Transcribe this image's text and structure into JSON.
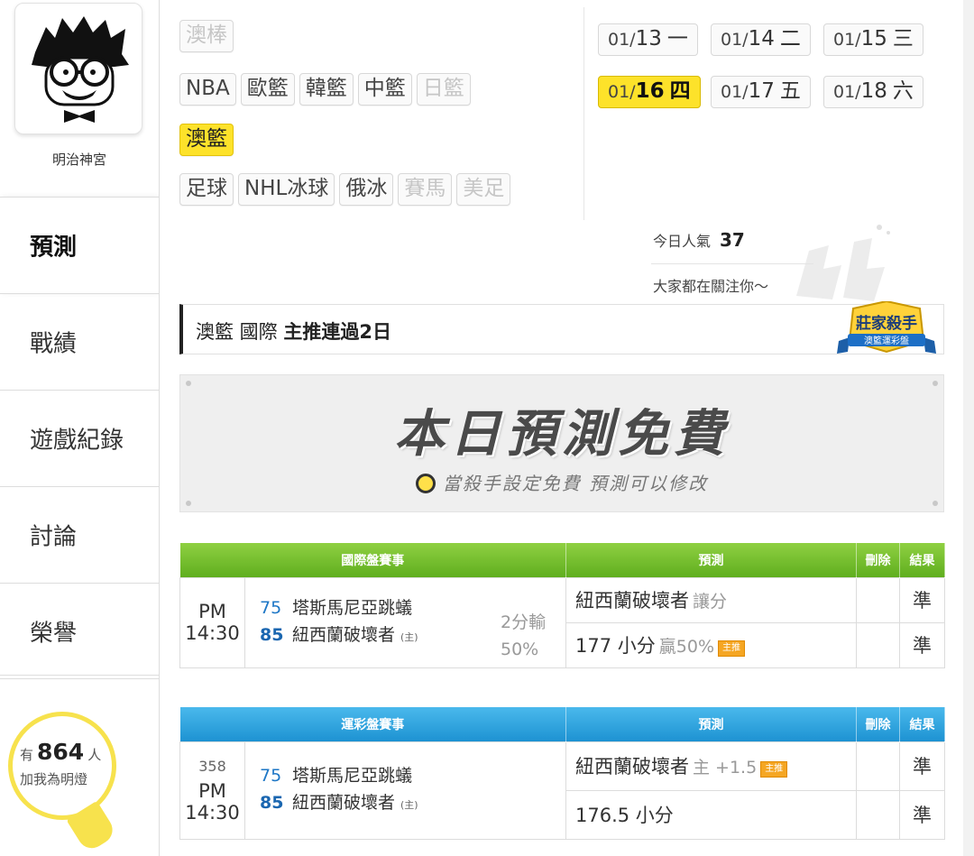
{
  "profile": {
    "name": "明治神宮"
  },
  "nav": [
    {
      "label": "預測"
    },
    {
      "label": "戰績"
    },
    {
      "label": "遊戲紀錄"
    },
    {
      "label": "討論"
    },
    {
      "label": "榮譽"
    }
  ],
  "fans": {
    "prefix": "有",
    "count": "864",
    "suffix": "人",
    "line2": "加我為明燈"
  },
  "sports": {
    "row1": [
      {
        "label": "澳棒"
      }
    ],
    "row2": [
      {
        "label": "NBA"
      },
      {
        "label": "歐籃"
      },
      {
        "label": "韓籃"
      },
      {
        "label": "中籃"
      },
      {
        "label": "日籃"
      }
    ],
    "row3": [
      {
        "label": "澳籃"
      }
    ],
    "row4": [
      {
        "label": "足球"
      },
      {
        "label": "NHL冰球"
      },
      {
        "label": "俄冰"
      },
      {
        "label": "賽馬"
      },
      {
        "label": "美足"
      }
    ]
  },
  "dates": [
    {
      "md": "01/",
      "day": "13",
      "wd": "一"
    },
    {
      "md": "01/",
      "day": "14",
      "wd": "二"
    },
    {
      "md": "01/",
      "day": "15",
      "wd": "三"
    },
    {
      "md": "01/",
      "day": "16",
      "wd": "四"
    },
    {
      "md": "01/",
      "day": "17",
      "wd": "五"
    },
    {
      "md": "01/",
      "day": "18",
      "wd": "六"
    }
  ],
  "popularity": {
    "label": "今日人氣",
    "value": "37",
    "subtitle": "大家都在關注你～"
  },
  "streak": {
    "league": "澳籃 國際",
    "text": "主推連過2日",
    "badge_top": "莊家殺手",
    "badge_bottom": "澳籃運彩盤"
  },
  "free_banner": {
    "title": "本日預測免費",
    "subtitle": "當殺手設定免費 預測可以修改"
  },
  "intl_table": {
    "headers": {
      "game": "國際盤賽事",
      "pred": "預測",
      "del": "刪除",
      "result": "結果"
    },
    "time": "PM 14:30",
    "away": {
      "score": "75",
      "team": "塔斯馬尼亞跳蟻"
    },
    "home": {
      "score": "85",
      "team": "紐西蘭破壞者",
      "mark": "(主)"
    },
    "spread": "2分輸",
    "spread_pct": "50%",
    "pred1": {
      "main": "紐西蘭破壞者",
      "note": "讓分",
      "result": "準"
    },
    "pred2": {
      "main": "177 小分",
      "note": "贏50%",
      "tag": "主推",
      "result": "準"
    }
  },
  "lottery_table": {
    "headers": {
      "game": "運彩盤賽事",
      "pred": "預測",
      "del": "刪除",
      "result": "結果"
    },
    "number": "358",
    "time": "PM 14:30",
    "away": {
      "score": "75",
      "team": "塔斯馬尼亞跳蟻"
    },
    "home": {
      "score": "85",
      "team": "紐西蘭破壞者",
      "mark": "(主)"
    },
    "pred1": {
      "main": "紐西蘭破壞者",
      "note": "主 +1.5",
      "tag": "主推",
      "result": "準"
    },
    "pred2": {
      "main": "176.5 小分",
      "result": "準"
    }
  },
  "colors": {
    "highlight": "#fde22a",
    "green_header": "#6cbd2a",
    "blue_header": "#2aa0dc",
    "win": "#2a9a2a",
    "score": "#1e77c6"
  }
}
